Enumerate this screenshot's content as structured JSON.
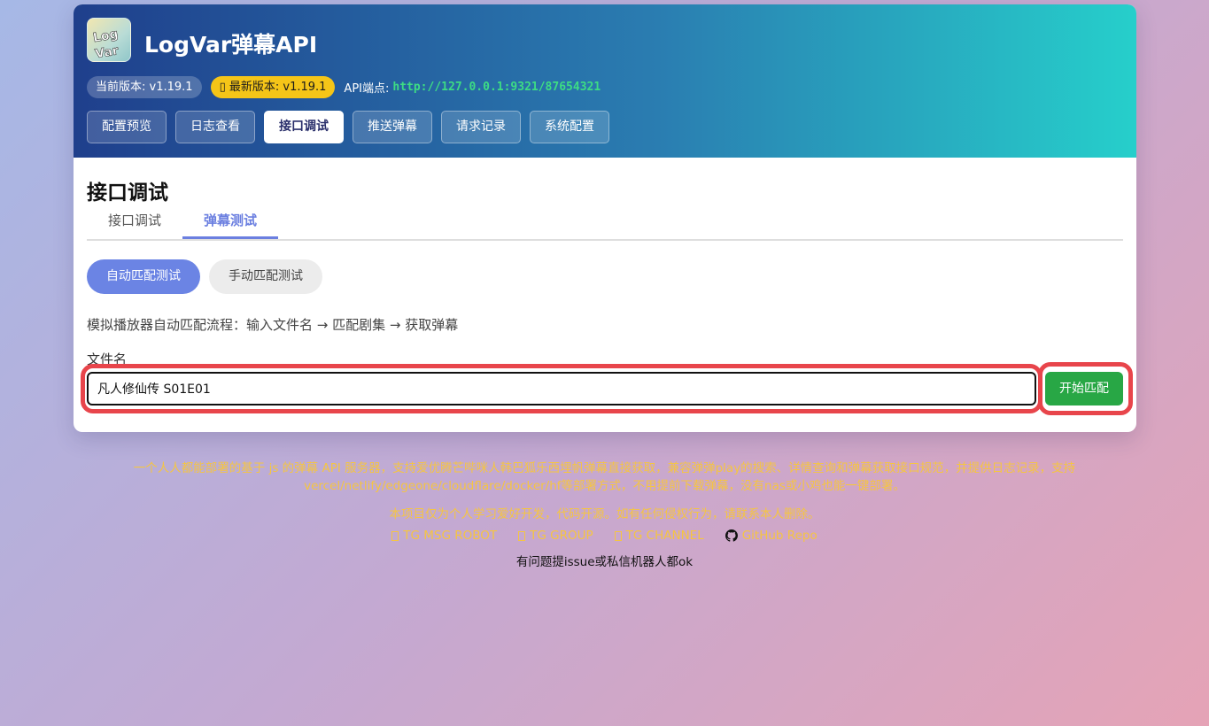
{
  "header": {
    "title": "LogVar弹幕API",
    "current_version": "当前版本: v1.19.1",
    "latest_version": "最新版本: v1.19.1",
    "endpoint_label": "API端点:",
    "endpoint_url": "http://127.0.0.1:9321/87654321"
  },
  "nav": {
    "items": [
      {
        "label": "配置预览"
      },
      {
        "label": "日志查看"
      },
      {
        "label": "接口调试"
      },
      {
        "label": "推送弹幕"
      },
      {
        "label": "请求记录"
      },
      {
        "label": "系统配置"
      }
    ],
    "active": "接口调试"
  },
  "main": {
    "title": "接口调试",
    "subtabs": [
      {
        "label": "接口调试"
      },
      {
        "label": "弹幕测试"
      }
    ],
    "active_subtab": "弹幕测试",
    "modes": [
      {
        "label": "自动匹配测试"
      },
      {
        "label": "手动匹配测试"
      }
    ],
    "active_mode": "自动匹配测试",
    "description": "模拟播放器自动匹配流程：输入文件名 → 匹配剧集 → 获取弹幕",
    "file_label": "文件名",
    "file_value": "凡人修仙传 S01E01",
    "match_button": "开始匹配"
  },
  "footer": {
    "description": "一个人人都能部署的基于 js 的弹幕 API 服务器，支持爱优腾芒哔咪人韩巴狐乐西埋帆弹幕直接获取，兼容弹弹play的搜索、详情查询和弹幕获取接口规范，并提供日志记录，支持vercel/netlify/edgeone/cloudflare/docker/hf等部署方式，不用提前下载弹幕，没有nas或小鸡也能一键部署。",
    "notice": "本项目仅为个人学习爱好开发，代码开源。如有任何侵权行为，请联系本人删除。",
    "links": [
      {
        "label": "TG MSG ROBOT"
      },
      {
        "label": "TG GROUP"
      },
      {
        "label": "TG CHANNEL"
      },
      {
        "label": "GitHub Repo"
      }
    ],
    "tip": "有问题提issue或私信机器人都ok"
  },
  "colors": {
    "accent": "#6b84e4",
    "highlight": "#e8454b",
    "success": "#28a745",
    "footer_text": "#f5c542"
  }
}
